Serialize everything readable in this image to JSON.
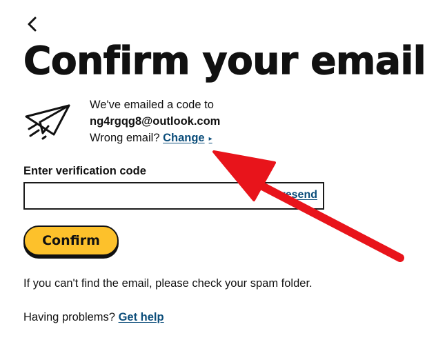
{
  "page": {
    "title": "Confirm your email"
  },
  "info": {
    "line1": "We've emailed a code to",
    "email": "ng4rgqg8@outlook.com",
    "wrong_email_prefix": "Wrong email?",
    "change_link": "Change",
    "change_arrow_glyph": "▸"
  },
  "verification": {
    "label": "Enter verification code",
    "value": "",
    "placeholder": "",
    "resend_link": "resend"
  },
  "confirm_button": {
    "label": "Confirm"
  },
  "footer": {
    "spam_text": "If you can't find the email, please check your spam folder.",
    "problems_prefix": "Having problems?",
    "help_link": "Get help"
  },
  "colors": {
    "accent_yellow": "#fdc12b",
    "link_blue": "#0b4d7a",
    "annotation_red": "#e8141b"
  },
  "icons": {
    "back": "chevron-left-icon",
    "plane": "paper-plane-icon"
  }
}
